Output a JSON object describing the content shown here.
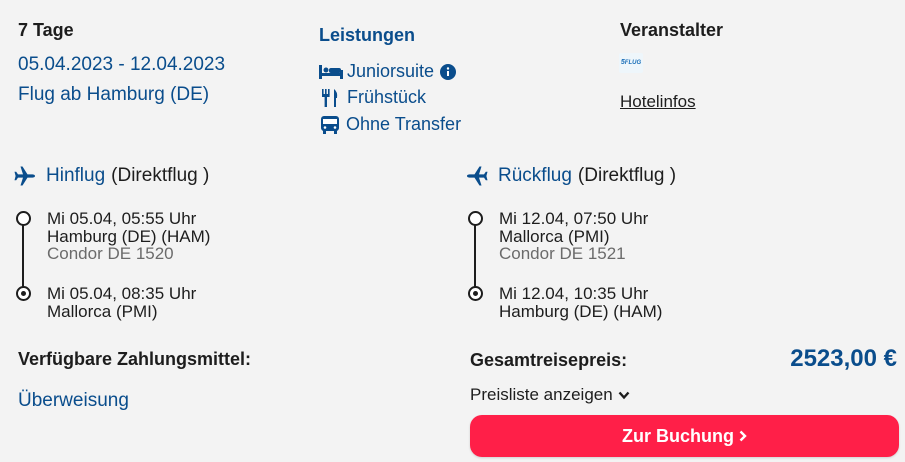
{
  "trip": {
    "duration": "7 Tage",
    "dates": "05.04.2023 - 12.04.2023",
    "origin": "Flug ab Hamburg (DE)"
  },
  "services": {
    "title": "Leistungen",
    "items": [
      {
        "label": "Juniorsuite",
        "icon": "bed-icon"
      },
      {
        "label": "Frühstück",
        "icon": "cutlery-icon"
      },
      {
        "label": "Ohne Transfer",
        "icon": "bus-icon"
      }
    ]
  },
  "operator": {
    "title": "Veranstalter",
    "logo_text": "5vorFLUG",
    "hotel_link": "Hotelinfos"
  },
  "outbound": {
    "label": "Hinflug",
    "type": "(Direktflug )",
    "dep_time": "Mi 05.04, 05:55 Uhr",
    "dep_airport": "Hamburg (DE) (HAM)",
    "flight": "Condor DE 1520",
    "arr_time": "Mi 05.04, 08:35 Uhr",
    "arr_airport": "Mallorca (PMI)"
  },
  "return": {
    "label": "Rückflug",
    "type": "(Direktflug )",
    "dep_time": "Mi 12.04, 07:50 Uhr",
    "dep_airport": "Mallorca (PMI)",
    "flight": "Condor DE 1521",
    "arr_time": "Mi 12.04, 10:35 Uhr",
    "arr_airport": "Hamburg (DE) (HAM)"
  },
  "payment": {
    "title": "Verfügbare Zahlungsmittel:",
    "method": "Überweisung"
  },
  "price": {
    "label": "Gesamtreisepreis:",
    "total": "2523,00 €",
    "pricelist_link": "Preisliste anzeigen",
    "book_button": "Zur Buchung"
  },
  "colors": {
    "accent_blue": "#0a4d8c",
    "button_red": "#ff1f48"
  }
}
